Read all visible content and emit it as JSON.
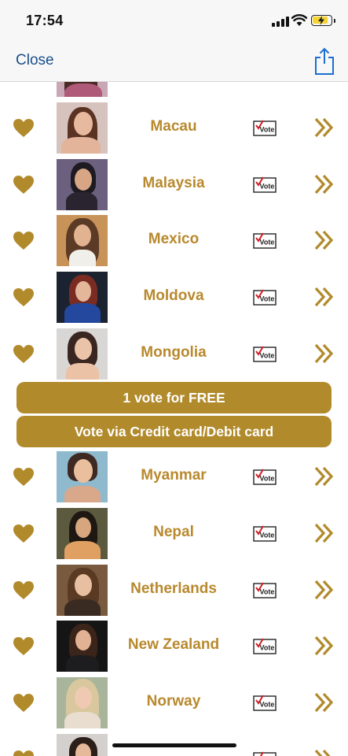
{
  "status_bar": {
    "time": "17:54"
  },
  "nav": {
    "close_label": "Close",
    "share_icon": "share-icon"
  },
  "accent_color": "#b18a2b",
  "rows_top": [
    {
      "country": "Macau"
    },
    {
      "country": "Malaysia"
    },
    {
      "country": "Mexico"
    },
    {
      "country": "Moldova"
    },
    {
      "country": "Mongolia"
    }
  ],
  "buttons": {
    "free_vote": "1 vote for FREE",
    "paid_vote": "Vote via Credit card/Debit card"
  },
  "rows_bottom": [
    {
      "country": "Myanmar"
    },
    {
      "country": "Nepal"
    },
    {
      "country": "Netherlands"
    },
    {
      "country": "New Zealand"
    },
    {
      "country": "Norway"
    }
  ],
  "vote_icon_label": "Vote"
}
